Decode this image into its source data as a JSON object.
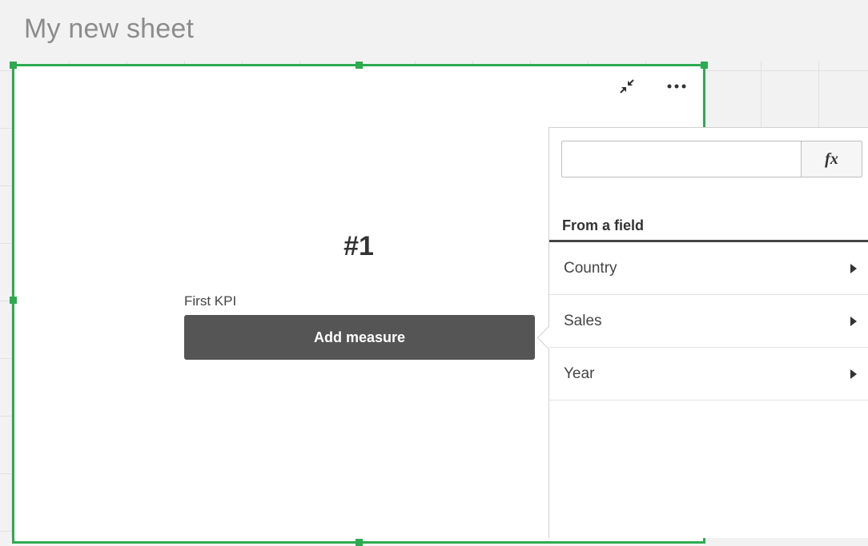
{
  "sheet": {
    "title": "My new sheet"
  },
  "kpi": {
    "value": "#1",
    "label": "First KPI",
    "add_measure_label": "Add measure"
  },
  "popover": {
    "expression": {
      "value": "",
      "fx_label": "fx"
    },
    "section_title": "From a field",
    "fields": [
      {
        "label": "Country"
      },
      {
        "label": "Sales"
      },
      {
        "label": "Year"
      }
    ]
  },
  "colors": {
    "selection_border": "#2dab51",
    "button_bg": "#555555",
    "title_text": "#8c8c8c"
  },
  "icons": {
    "exit_fullscreen": "exit-fullscreen-icon",
    "more": "more-icon",
    "expand_field": "caret-right-icon"
  }
}
